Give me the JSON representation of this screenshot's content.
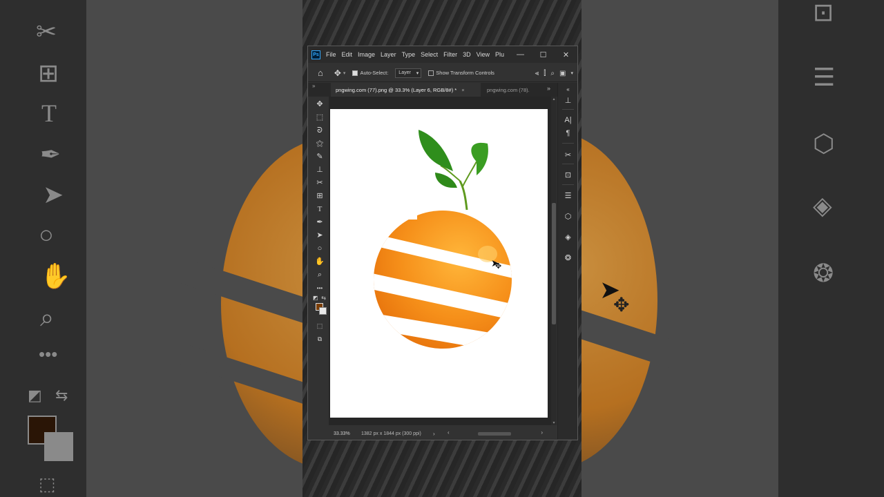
{
  "app": {
    "logo": "Ps",
    "menu": [
      "File",
      "Edit",
      "Image",
      "Layer",
      "Type",
      "Select",
      "Filter",
      "3D",
      "View",
      "Plu"
    ],
    "window_controls": {
      "minimize": "—",
      "maximize": "☐",
      "close": "✕"
    }
  },
  "options_bar": {
    "auto_select_label": "Auto-Select:",
    "auto_select_checked": true,
    "auto_select_target": "Layer",
    "show_transform_label": "Show Transform Controls",
    "show_transform_checked": false
  },
  "tabs": {
    "active_label": "pngwing.com (77).png @ 33.3% (Layer 6, RGB/8#) *",
    "active_close": "×",
    "inactive_label": "pngwing.com (78).",
    "more": "»"
  },
  "status": {
    "zoom": "33.33%",
    "doc_info": "1382 px x 1844 px (300 ppi)",
    "next_arrow": "›",
    "scroll_left": "‹",
    "scroll_right": "›"
  },
  "colors": {
    "foreground": "#7a3d05",
    "background": "#e9e9e9",
    "accent": "#31a8ff"
  },
  "icons": {
    "toolbar": [
      "move-icon",
      "marquee-icon",
      "lasso-icon",
      "magic-wand-icon",
      "brush-icon",
      "stamp-icon",
      "eraser-icon",
      "frame-icon",
      "type-icon",
      "pen-icon",
      "path-select-icon",
      "ellipse-icon",
      "hand-icon",
      "zoom-icon",
      "more-tools-icon"
    ],
    "right_panel": [
      "clone-source-icon",
      "character-icon",
      "paragraph-icon",
      "tools-icon",
      "libraries-icon",
      "adjustments-icon",
      "3d-icon",
      "layers-icon",
      "channels-icon"
    ]
  }
}
